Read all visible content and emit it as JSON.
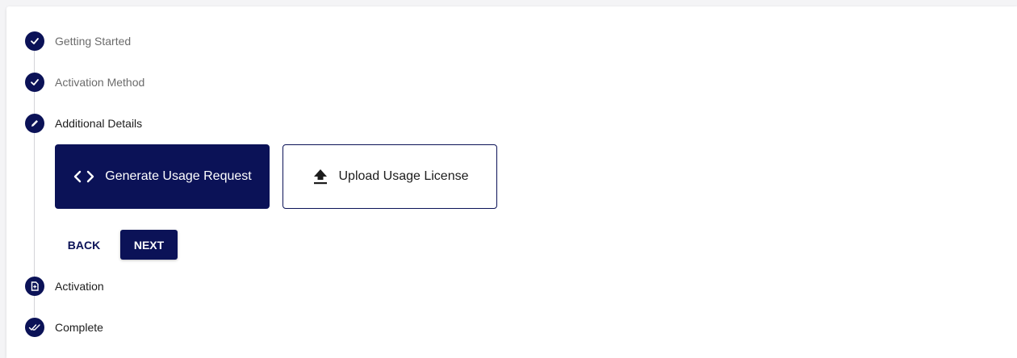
{
  "stepper": {
    "steps": [
      {
        "label": "Getting Started",
        "icon": "check-icon",
        "state": "completed"
      },
      {
        "label": "Activation Method",
        "icon": "check-icon",
        "state": "completed"
      },
      {
        "label": "Additional Details",
        "icon": "pencil-icon",
        "state": "active"
      },
      {
        "label": "Activation",
        "icon": "document-icon",
        "state": "pending"
      },
      {
        "label": "Complete",
        "icon": "double-check-icon",
        "state": "pending"
      }
    ]
  },
  "options": {
    "generate_label": "Generate Usage Request",
    "upload_label": "Upload Usage License"
  },
  "actions": {
    "back_label": "BACK",
    "next_label": "NEXT"
  },
  "colors": {
    "primary": "#0b1257",
    "inactive_text": "#6b6b6b",
    "active_text": "#1c1c1c"
  }
}
